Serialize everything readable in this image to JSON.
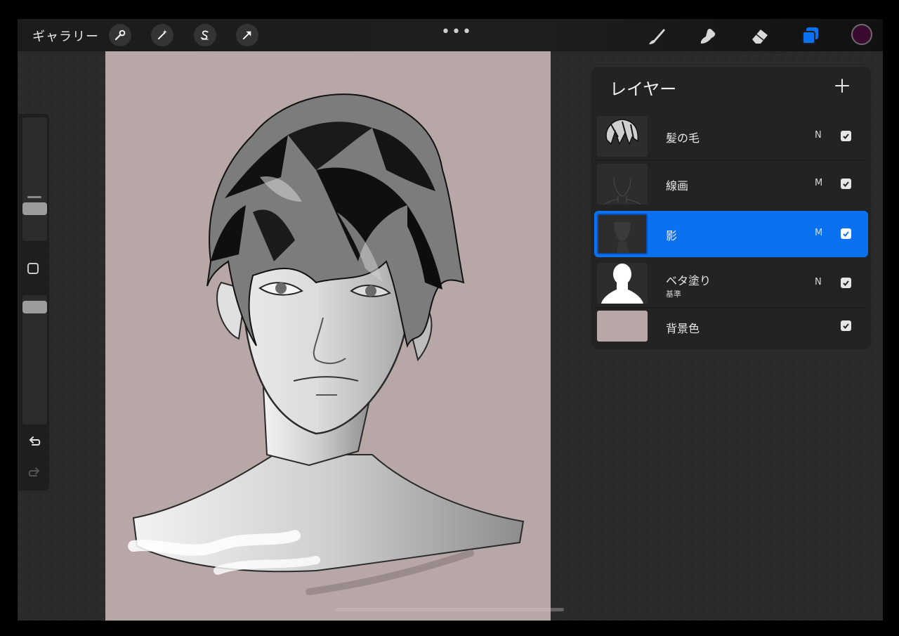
{
  "topbar": {
    "gallery_label": "ギャラリー",
    "tools_left": [
      "wrench-icon",
      "magic-wand-icon",
      "selection-s-icon",
      "transform-arrow-icon"
    ],
    "more_label": "•••",
    "tools_right": [
      "brush-icon",
      "smudge-icon",
      "eraser-icon",
      "layers-icon"
    ],
    "current_color": "#3a0b2e"
  },
  "layers_panel": {
    "title": "レイヤー",
    "add_label": "+",
    "items": [
      {
        "name": "髪の毛",
        "sub": "",
        "mode": "N",
        "visible": true,
        "selected": false
      },
      {
        "name": "線画",
        "sub": "",
        "mode": "M",
        "visible": true,
        "selected": false
      },
      {
        "name": "影",
        "sub": "",
        "mode": "M",
        "visible": true,
        "selected": true
      },
      {
        "name": "ベタ塗り",
        "sub": "基準",
        "mode": "N",
        "visible": true,
        "selected": false
      },
      {
        "name": "背景色",
        "sub": "",
        "mode": "",
        "visible": true,
        "selected": false
      }
    ]
  },
  "colors": {
    "accent": "#0a72f0",
    "canvas_bg": "#b7a7a7",
    "background_layer": "#b7a7a7"
  },
  "sidebar": {
    "undo_icon": "undo-icon",
    "redo_icon": "redo-icon"
  }
}
